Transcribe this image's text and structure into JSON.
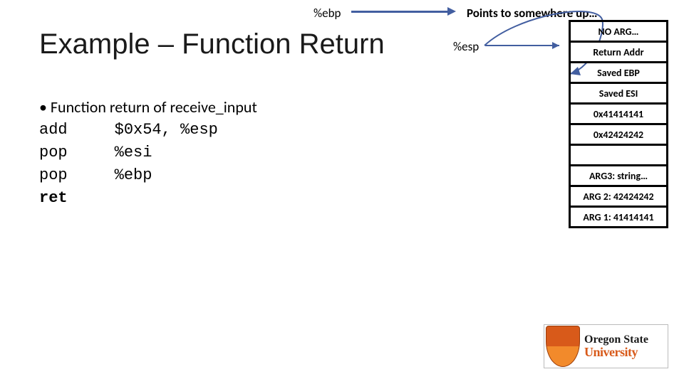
{
  "ebp_label": "%ebp",
  "points_text": "Points to somewhere up…",
  "title": "Example – Function Return",
  "esp_label": "%esp",
  "bullet": "• Function return of receive_input",
  "code": {
    "l1a": "add",
    "l1b": "$0x54, %esp",
    "l2a": "pop",
    "l2b": "%esi",
    "l3a": "pop",
    "l3b": "%ebp",
    "l4a": "ret"
  },
  "stack": {
    "c0": "NO ARG…",
    "c1": "Return Addr",
    "c2": "Saved EBP",
    "c3": "Saved ESI",
    "c4": "0x41414141",
    "c5": "0x42424242",
    "c6": "",
    "c7": "ARG3: string…",
    "c8": "ARG 2: 42424242",
    "c9": "ARG 1: 41414141"
  },
  "logo": {
    "line1": "Oregon State",
    "line2": "University"
  },
  "colors": {
    "arrow": "#425ea0",
    "logo_orange": "#d85a1a"
  }
}
